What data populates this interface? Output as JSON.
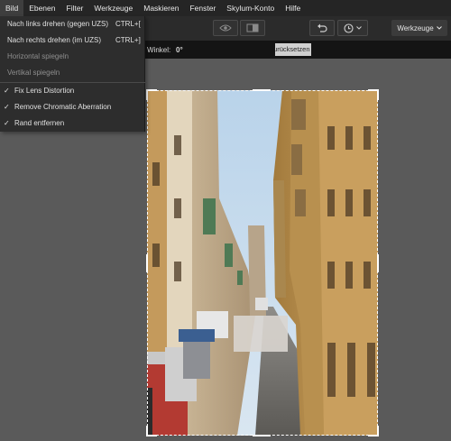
{
  "menubar": {
    "items": [
      "Bild",
      "Ebenen",
      "Filter",
      "Werkzeuge",
      "Maskieren",
      "Fenster",
      "Skylum-Konto",
      "Hilfe"
    ]
  },
  "toolbar": {
    "preview_icon": "eye-icon",
    "compare_icon": "split-view-icon",
    "undo_icon": "undo-icon",
    "history_icon": "clock-icon",
    "tools_select_label": "Werkzeuge"
  },
  "options": {
    "angle_label": "Winkel:",
    "angle_value": "0°",
    "reset_label": "Zurücksetzen"
  },
  "dropdown": {
    "items": [
      {
        "label": "Nach links drehen (gegen UZS)",
        "shortcut": "CTRL+[",
        "enabled": true,
        "checked": false
      },
      {
        "label": "Nach rechts drehen (im UZS)",
        "shortcut": "CTRL+]",
        "enabled": true,
        "checked": false
      },
      {
        "label": "Horizontal spiegeln",
        "shortcut": "",
        "enabled": false,
        "checked": false
      },
      {
        "label": "Vertikal spiegeln",
        "shortcut": "",
        "enabled": false,
        "checked": false
      },
      {
        "label": "Fix Lens Distortion",
        "shortcut": "",
        "enabled": true,
        "checked": true
      },
      {
        "label": "Remove Chromatic Aberration",
        "shortcut": "",
        "enabled": true,
        "checked": true
      },
      {
        "label": "Rand entfernen",
        "shortcut": "",
        "enabled": true,
        "checked": true
      }
    ]
  },
  "colors": {
    "menubar_bg": "#252525",
    "toolbar_bg": "#2b2b2b",
    "canvas_bg": "#5a5a5a",
    "crop_border": "#ffffff"
  }
}
